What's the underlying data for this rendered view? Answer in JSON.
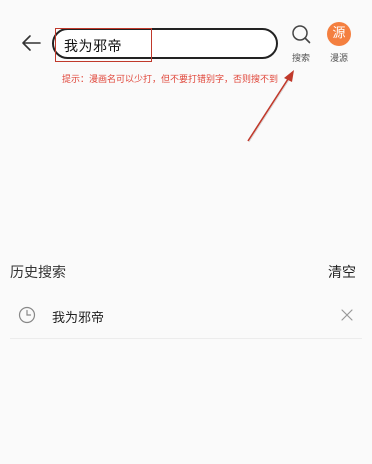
{
  "header": {
    "search_value": "我为邪帝",
    "search_label": "搜索",
    "source_badge": "源",
    "source_label": "漫源"
  },
  "hint": "提示：漫画名可以少打，但不要打错别字，否则搜不到",
  "history": {
    "title": "历史搜索",
    "clear_label": "清空",
    "items": [
      {
        "text": "我为邪帝"
      }
    ]
  },
  "colors": {
    "accent": "#f47f3f",
    "annotation": "#c0392b",
    "hint_text": "#e0463a"
  },
  "icons": [
    "back-arrow-icon",
    "search-icon",
    "clock-icon",
    "close-icon"
  ]
}
